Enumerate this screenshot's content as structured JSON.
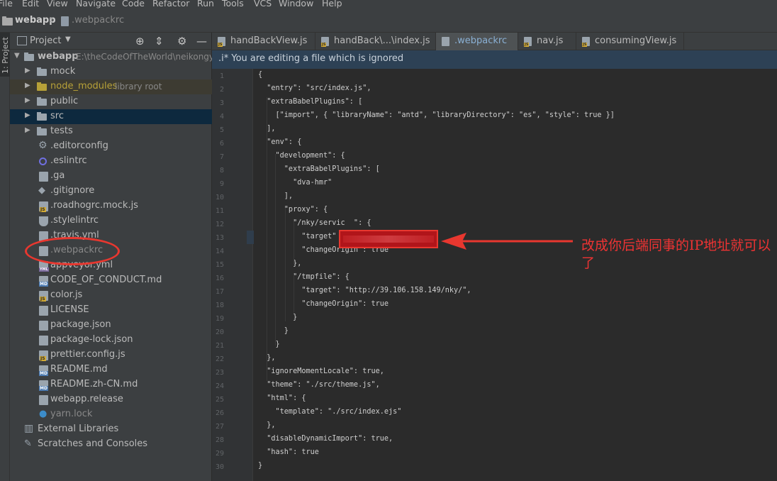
{
  "menu": [
    "File",
    "Edit",
    "View",
    "Navigate",
    "Code",
    "Refactor",
    "Run",
    "Tools",
    "VCS",
    "Window",
    "Help"
  ],
  "breadcrumb": {
    "project": "webapp",
    "file": ".webpackrc"
  },
  "left_strip": {
    "label": "1: Project"
  },
  "project_panel": {
    "title": "Project",
    "tree": [
      {
        "label": "webapp",
        "extra": "E:\\theCodeOfTheWorld\\neikongy"
      },
      {
        "label": "mock"
      },
      {
        "label": "node_modules",
        "extra": "library root"
      },
      {
        "label": "public"
      },
      {
        "label": "src"
      },
      {
        "label": "tests"
      },
      {
        "label": ".editorconfig"
      },
      {
        "label": ".eslintrc"
      },
      {
        "label": ".ga"
      },
      {
        "label": ".gitignore"
      },
      {
        "label": ".roadhogrc.mock.js"
      },
      {
        "label": ".stylelintrc"
      },
      {
        "label": ".travis.yml"
      },
      {
        "label": ".webpackrc"
      },
      {
        "label": "appveyor.yml"
      },
      {
        "label": "CODE_OF_CONDUCT.md"
      },
      {
        "label": "color.js"
      },
      {
        "label": "LICENSE"
      },
      {
        "label": "package.json"
      },
      {
        "label": "package-lock.json"
      },
      {
        "label": "prettier.config.js"
      },
      {
        "label": "README.md"
      },
      {
        "label": "README.zh-CN.md"
      },
      {
        "label": "webapp.release"
      },
      {
        "label": "yarn.lock"
      },
      {
        "label": "External Libraries"
      },
      {
        "label": "Scratches and Consoles"
      }
    ]
  },
  "tabs": [
    "handBackView.js",
    "handBack\\...\\index.js",
    ".webpackrc",
    "nav.js",
    "consumingView.js"
  ],
  "banner": ".i* You are editing a file which is ignored",
  "code_lines": [
    "{",
    "  \"entry\": \"src/index.js\",",
    "  \"extraBabelPlugins\": [",
    "    [\"import\", { \"libraryName\": \"antd\", \"libraryDirectory\": \"es\", \"style\": true }]",
    "  ],",
    "  \"env\": {",
    "    \"development\": {",
    "      \"extraBabelPlugins\": [",
    "        \"dva-hmr\"",
    "      ],",
    "      \"proxy\": {",
    "        \"/nky/servic  \": {",
    "          \"target\"",
    "          \"changeOrigin\": true",
    "        },",
    "        \"/tmpfile\": {",
    "          \"target\": \"http://39.106.158.149/nky/\",",
    "          \"changeOrigin\": true",
    "        }",
    "      }",
    "    }",
    "  },",
    "  \"ignoreMomentLocale\": true,",
    "  \"theme\": \"./src/theme.js\",",
    "  \"html\": {",
    "    \"template\": \"./src/index.ejs\"",
    "  },",
    "  \"disableDynamicImport\": true,",
    "  \"hash\": true",
    "}"
  ],
  "annotation": "改成你后端同事的IP地址就可以了",
  "colors": {
    "annotation_red": "#e8372f",
    "active_tab_text": "#8ab0d4",
    "banner_bg": "#2d4155"
  }
}
